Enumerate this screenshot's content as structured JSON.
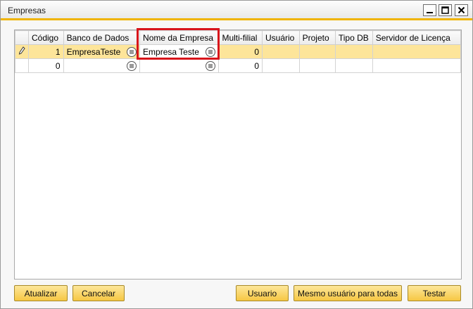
{
  "window": {
    "title": "Empresas",
    "controls": [
      "minimize-icon",
      "maximize-icon",
      "close-icon"
    ]
  },
  "grid": {
    "columns": [
      "",
      "Código",
      "Banco de Dados",
      "Nome da Empresa",
      "Multi-filial",
      "Usuário",
      "Projeto",
      "Tipo DB",
      "Servidor de Licença"
    ],
    "rows": [
      {
        "selected": true,
        "row_icon": "edit-pencil-icon",
        "codigo": "1",
        "banco": "EmpresaTeste",
        "nome": "Empresa Teste",
        "multifilial": "0",
        "usuario": "",
        "projeto": "",
        "tipodb": "",
        "servidor": ""
      },
      {
        "selected": false,
        "row_icon": "",
        "codigo": "0",
        "banco": "",
        "nome": "",
        "multifilial": "0",
        "usuario": "",
        "projeto": "",
        "tipodb": "",
        "servidor": ""
      }
    ],
    "link_icon": "link-arrow-icon"
  },
  "buttons": {
    "atualizar": "Atualizar",
    "cancelar": "Cancelar",
    "usuario": "Usuario",
    "mesmo_usuario": "Mesmo usuário para todas",
    "testar": "Testar"
  },
  "colors": {
    "title_accent": "#f0b400",
    "selected_row": "#fde59a",
    "button": "#f6c744",
    "highlight_box": "#d8141b"
  }
}
